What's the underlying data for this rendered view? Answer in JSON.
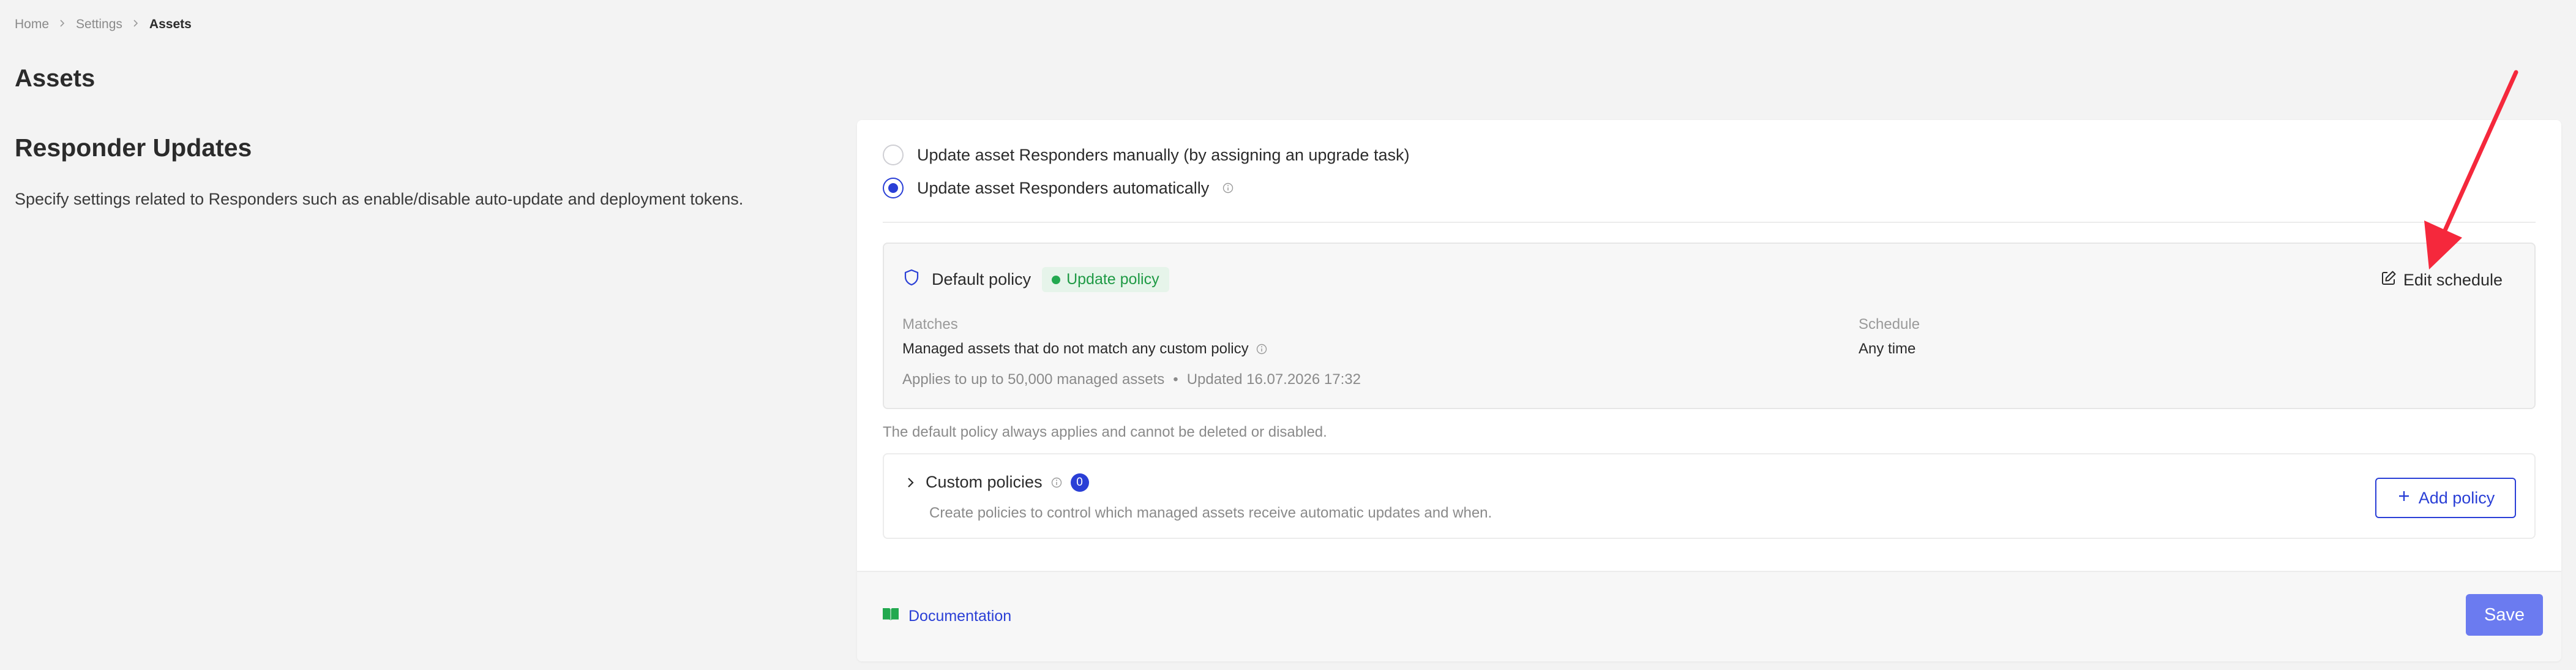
{
  "breadcrumb": {
    "items": [
      "Home",
      "Settings",
      "Assets"
    ]
  },
  "page": {
    "title": "Assets"
  },
  "section": {
    "title": "Responder Updates",
    "description": "Specify settings related to Responders such as enable/disable auto-update and deployment tokens."
  },
  "update_mode": {
    "options": [
      {
        "label": "Update asset Responders manually (by assigning an upgrade task)",
        "selected": false
      },
      {
        "label": "Update asset Responders automatically",
        "selected": true
      }
    ]
  },
  "default_policy": {
    "name": "Default policy",
    "badge": "Update policy",
    "edit_label": "Edit schedule",
    "matches_label": "Matches",
    "matches_value": "Managed assets that do not match any custom policy",
    "schedule_label": "Schedule",
    "schedule_value": "Any time",
    "applies": "Applies to up to 50,000 managed assets",
    "separator": "•",
    "updated": "Updated 16.07.2026 17:32",
    "note": "The default policy always applies and cannot be deleted or disabled."
  },
  "custom_policies": {
    "title": "Custom policies",
    "count": "0",
    "description": "Create policies to control which managed assets receive automatic updates and when.",
    "add_label": "Add policy"
  },
  "footer": {
    "documentation_label": "Documentation",
    "save_label": "Save"
  },
  "colors": {
    "accent": "#2a3fd6",
    "save_button": "#6b7bf0",
    "badge_green": "#1f9a45",
    "annotation_arrow": "#f5283c",
    "documentation_icon": "#22a94f"
  }
}
